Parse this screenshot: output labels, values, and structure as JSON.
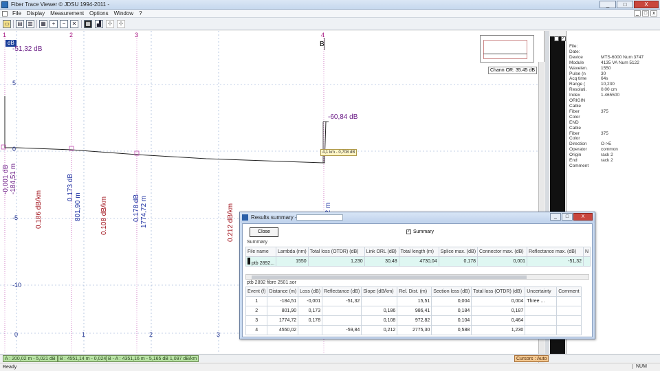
{
  "window": {
    "title": "Fiber Trace Viewer © JDSU 1994-2011 -",
    "buttons": {
      "minimize": "_",
      "maximize": "□",
      "close": "X"
    }
  },
  "menu": [
    "File",
    "Display",
    "Measurement",
    "Options",
    "Window",
    "?"
  ],
  "mdi_buttons": [
    "_",
    "□",
    "x"
  ],
  "graph": {
    "unit_badge": "dB",
    "reference_db": "-51,32 dB",
    "marker_numbers": [
      "1",
      "2",
      "3",
      "4"
    ],
    "y_ticks": [
      "5",
      "0",
      "-5",
      "-10"
    ],
    "x_ticks": [
      "0",
      "1",
      "2",
      "3"
    ],
    "cursor_label": "B",
    "cursor_db": "-60,84 dB",
    "tooltip": "4,1 km - 0,708 dB",
    "channel_or": "Chann OR: 35.45 dB",
    "event_labels": {
      "e1_loss": "-0,001 dB",
      "e1_dist": "-184,51 m",
      "slope1": "0.186 dB/km",
      "e2_loss": "0.173 dB",
      "e2_dist": "801,90 m",
      "slope2": "0.108 dB/km",
      "e3_loss": "0.178 dB",
      "e3_dist": "1774,72 m",
      "slope3": "0.212 dB/km",
      "e4_dist": "4550,02 m"
    }
  },
  "info_panel": {
    "rows": [
      {
        "k": "File:",
        "v": ""
      },
      {
        "k": "Date:",
        "v": ""
      },
      {
        "k": "Device",
        "v": "MTS-6000 Num 3747"
      },
      {
        "k": "Module",
        "v": "4135 VA Num 5122"
      },
      {
        "k": "Wavelen.",
        "v": "1550"
      },
      {
        "k": "Pulse (n",
        "v": "30"
      },
      {
        "k": "Acq time",
        "v": "64s"
      },
      {
        "k": "Range (",
        "v": "10,230"
      },
      {
        "k": "Resoluti.",
        "v": "0.00 cm"
      },
      {
        "k": "Index",
        "v": "1.465500"
      },
      {
        "k": "ORIGIN",
        "v": ""
      },
      {
        "k": "  Cable",
        "v": ""
      },
      {
        "k": "  Fiber",
        "v": "375"
      },
      {
        "k": "  Color",
        "v": ""
      },
      {
        "k": "END",
        "v": ""
      },
      {
        "k": "  Cable",
        "v": ""
      },
      {
        "k": "  Fiber",
        "v": "375"
      },
      {
        "k": "  Color",
        "v": ""
      },
      {
        "k": "Direction",
        "v": "O->E"
      },
      {
        "k": "Operator",
        "v": "common"
      },
      {
        "k": "Origin",
        "v": "rack 2"
      },
      {
        "k": "End",
        "v": "rack 2"
      },
      {
        "k": "Comment",
        "v": ""
      }
    ]
  },
  "status": {
    "a": "A : 200,02 m - 5,021 dB",
    "b": "B : 4551,14 m - 0,024 dB",
    "ba": "B - A : 4351,16 m - 5,165 dB  1,097 dB/km",
    "cursor": "Cursors : Auto",
    "ready": "Ready",
    "num": "NUM"
  },
  "results": {
    "title": "Results summary -",
    "close_label": "Close",
    "summary_check_label": "Summary",
    "summary_section": "Summary",
    "summary_headers": [
      "File name",
      "Lambda (nm)",
      "Total loss (OTDR) (dB)",
      "Link ORL (dB)",
      "Total length (m)",
      "Splice max. (dB)",
      "Connector max. (dB)",
      "Reflectance max. (dB)",
      "N"
    ],
    "summary_row": [
      "ptb 2892...",
      "1550",
      "1,230",
      "30,48",
      "4730,04",
      "0,178",
      "0,001",
      "-51,32",
      ""
    ],
    "detail_section": "ptb 2892 fibre 2501.sor",
    "event_headers": [
      "Event (f)",
      "Distance (m)",
      "Loss (dB)",
      "Reflectance (dB)",
      "Slope (dB/km)",
      "Rel. Dist. (m)",
      "Section loss (dB)",
      "Total loss (OTDR) (dB)",
      "Uncertainty",
      "Comment"
    ],
    "events": [
      {
        "num": "1",
        "distance": "-184,51",
        "loss": "-0,001",
        "reflectance": "-51,32",
        "slope": "",
        "rel_dist": "15,51",
        "section_loss": "0,004",
        "total_loss": "0,004",
        "uncertainty": "Three ...",
        "comment": ""
      },
      {
        "num": "2",
        "distance": "801,90",
        "loss": "0,173",
        "reflectance": "",
        "slope": "0,186",
        "rel_dist": "986,41",
        "section_loss": "0,184",
        "total_loss": "0,187",
        "uncertainty": "",
        "comment": ""
      },
      {
        "num": "3",
        "distance": "1774,72",
        "loss": "0,178",
        "reflectance": "",
        "slope": "0,108",
        "rel_dist": "972,82",
        "section_loss": "0,104",
        "total_loss": "0,464",
        "uncertainty": "",
        "comment": ""
      },
      {
        "num": "4",
        "distance": "4550,02",
        "loss": "",
        "reflectance": "-59,84",
        "slope": "0,212",
        "rel_dist": "2775,30",
        "section_loss": "0,588",
        "total_loss": "1,230",
        "uncertainty": "",
        "comment": ""
      }
    ]
  }
}
